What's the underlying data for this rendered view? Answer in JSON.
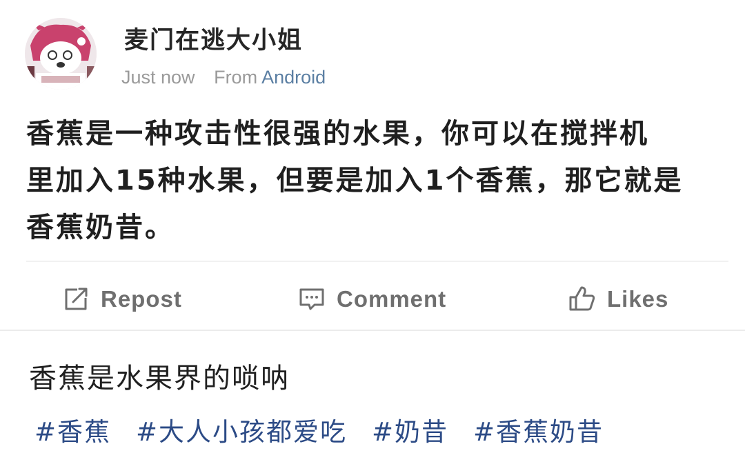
{
  "post": {
    "author": "麦门在逃大小姐",
    "time": "Just now",
    "from_label": "From",
    "device": "Android",
    "text_lines": [
      "香蕉是一种攻击性很强的水果，你可以在搅拌机",
      "里加入15种水果，但要是加入1个香蕉，那它就是",
      "香蕉奶昔。"
    ]
  },
  "actions": {
    "repost": {
      "label": "Repost",
      "icon": "repost-icon"
    },
    "comment": {
      "label": "Comment",
      "icon": "comment-icon"
    },
    "likes": {
      "label": "Likes",
      "icon": "thumbs-up-icon"
    }
  },
  "caption": "香蕉是水果界的唢呐",
  "hashtags": [
    "#香蕉",
    "#大人小孩都爱吃",
    "#奶昔",
    "#香蕉奶昔"
  ],
  "colors": {
    "link": "#2c4b86",
    "device": "#5b7fa3",
    "muted": "#9a9a9a"
  }
}
